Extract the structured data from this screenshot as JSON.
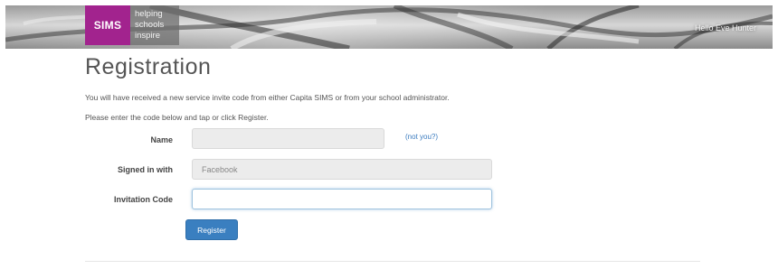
{
  "header": {
    "logo_text": "SIMS",
    "tagline": [
      "helping",
      "schools",
      "inspire"
    ],
    "user_menu": "Hello Eve Hunter"
  },
  "page": {
    "title": "Registration",
    "intro_line1": "You will have received a new service invite code from either Capita SIMS or from your school administrator.",
    "intro_line2": "Please enter the code below and tap or click Register."
  },
  "form": {
    "name_label": "Name",
    "name_value": "",
    "not_you_link": "(not you?)",
    "signed_in_label": "Signed in with",
    "signed_in_value": "Facebook",
    "invitation_label": "Invitation Code",
    "invitation_value": "",
    "register_label": "Register"
  },
  "colors": {
    "brand": "#a2238e",
    "primary_button": "#3a7fc0",
    "link": "#3a7bbf"
  }
}
